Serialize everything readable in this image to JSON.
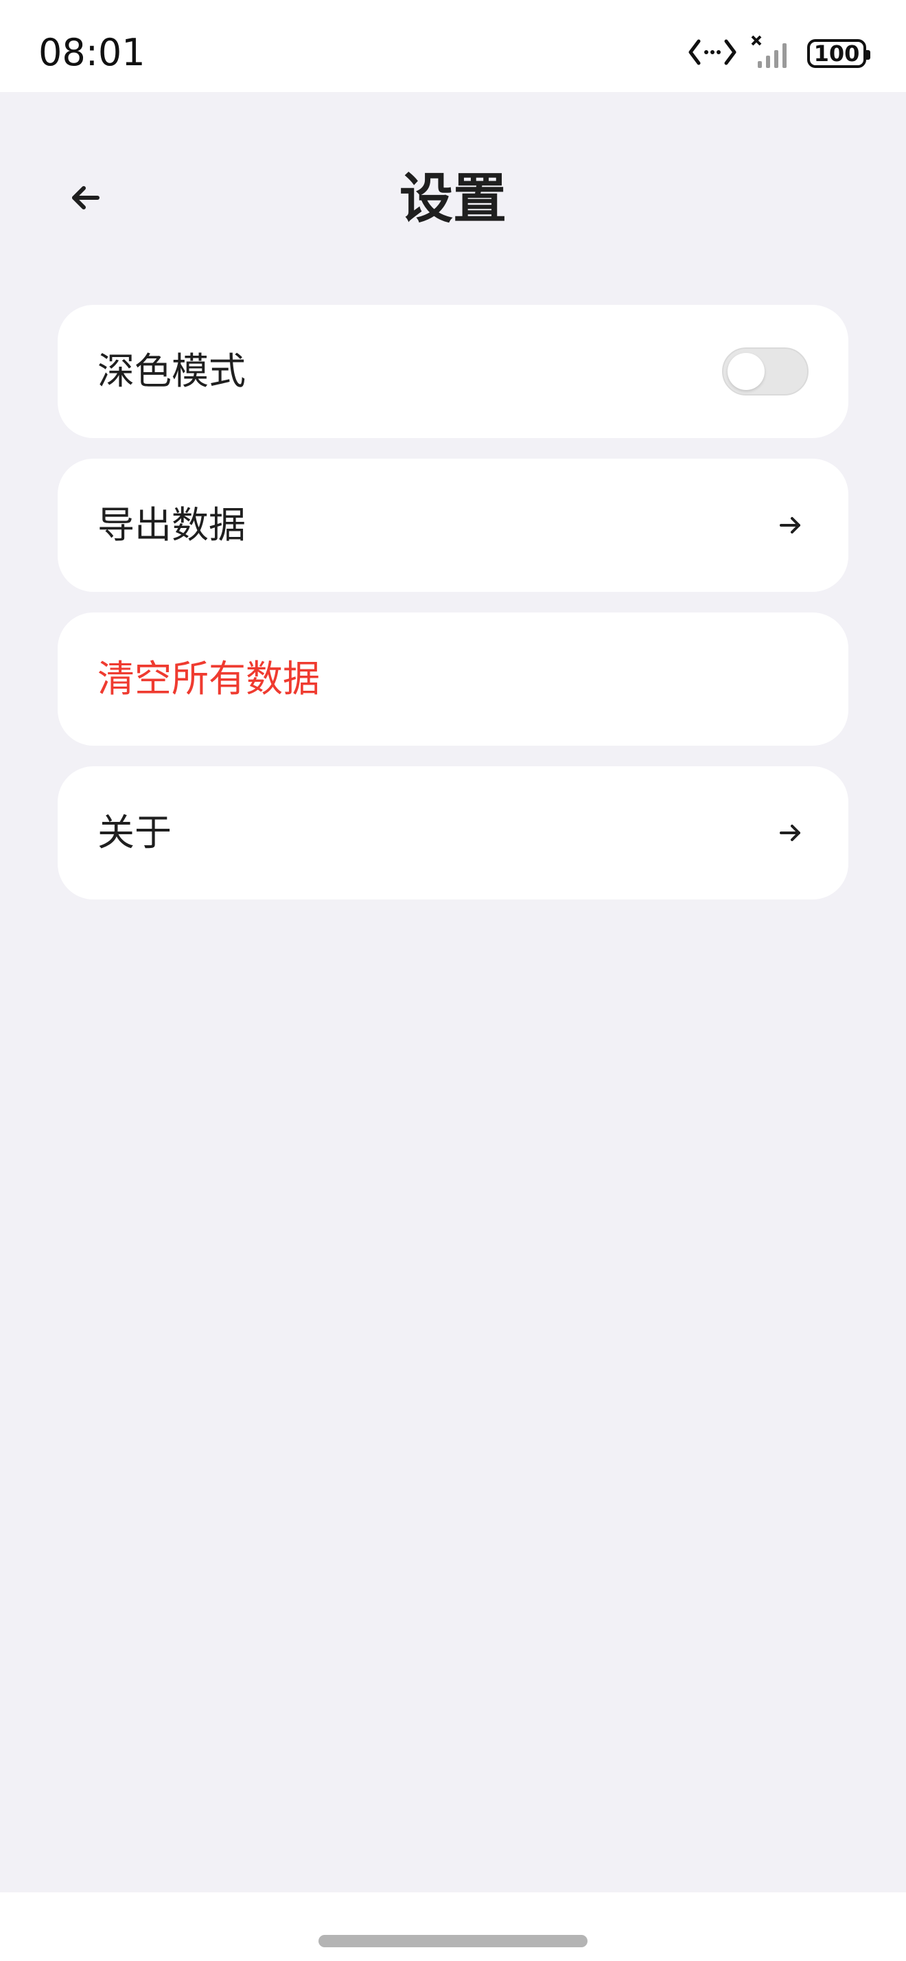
{
  "status_bar": {
    "time": "08:01",
    "battery": "100",
    "icons": [
      "data-transfer-icon",
      "no-signal-icon",
      "battery-icon"
    ]
  },
  "header": {
    "title": "设置",
    "back_icon": "arrow-left-icon"
  },
  "settings": {
    "dark_mode": {
      "label": "深色模式",
      "enabled": false
    },
    "export": {
      "label": "导出数据",
      "icon": "arrow-right-icon"
    },
    "clear": {
      "label": "清空所有数据",
      "color": "#ef3b30"
    },
    "about": {
      "label": "关于",
      "icon": "arrow-right-icon"
    }
  },
  "colors": {
    "background": "#f2f1f6",
    "card": "#ffffff",
    "danger": "#ef3b30",
    "text": "#1f1f1f"
  }
}
